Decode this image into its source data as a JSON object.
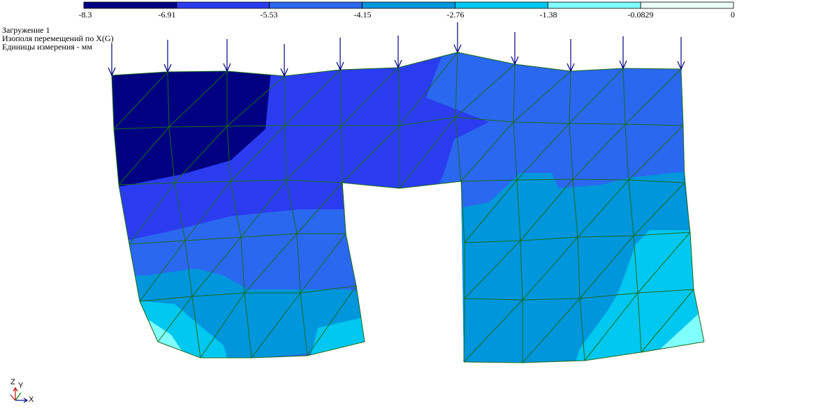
{
  "legend": {
    "ticks": [
      "-8.3",
      "-6.91",
      "-5.53",
      "-4.15",
      "-2.76",
      "-1.38",
      "-0.0829",
      "0"
    ],
    "colors": [
      "#000080",
      "#2b3cf0",
      "#2a68f0",
      "#0096dc",
      "#00c8f0",
      "#80ffff",
      "#ecfff8"
    ]
  },
  "info": {
    "line1": "Загружение  1",
    "line2": "Изополя перемещений по X(G)",
    "line3": "Единицы измерения - мм"
  },
  "axes": {
    "z": "Z",
    "y": "Y",
    "x": "X"
  },
  "colors": {
    "mesh": "#1a6b1a",
    "load": "#000080"
  }
}
